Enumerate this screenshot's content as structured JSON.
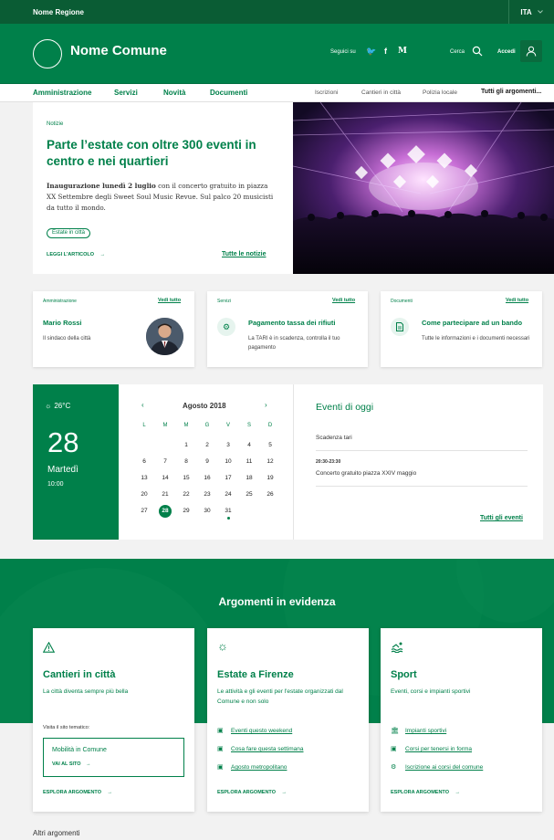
{
  "topbar": {
    "region": "Nome Regione",
    "lang": "ITA"
  },
  "header": {
    "comune": "Nome Comune",
    "follow": "Seguici su",
    "social": [
      "🐦",
      "f",
      "M"
    ],
    "search": "Cerca",
    "login": "Accedi"
  },
  "nav": {
    "main": [
      "Amministrazione",
      "Servizi",
      "Novità",
      "Documenti"
    ],
    "secondary": [
      "Iscrizioni",
      "Cantieri in città",
      "Polizia locale"
    ],
    "all": "Tutti gli argomenti..."
  },
  "hero": {
    "kicker": "Notizie",
    "title": "Parte l’estate con oltre 300 eventi in centro e nei quartieri",
    "text_bold": "Inaugurazione lunedì 2 luglio",
    "text_rest": " con il concerto gratuito in piazza XX Settembre degli Sweet Soul Music Revue. Sul palco 20 musicisti da tutto il mondo.",
    "chip": "Estate in città",
    "read_more": "LEGGI L'ARTICOLO",
    "all_news": "Tutte le notizie"
  },
  "cards": [
    {
      "kicker": "Amministrazione",
      "all": "Vedi tutto",
      "title": "Mario Rossi",
      "sub": "Il sindaco della città"
    },
    {
      "kicker": "Servizi",
      "all": "Vedi tutto",
      "title": "Pagamento tassa dei rifiuti",
      "sub": "La TARI è in scadenza, controlla il tuo pagamento"
    },
    {
      "kicker": "Documenti",
      "all": "Vedi tutto",
      "title": "Come partecipare ad un bando",
      "sub": "Tutte le informazioni e i documenti necessari"
    }
  ],
  "weather": {
    "temp": "26°C",
    "day": "28",
    "weekday": "Martedì",
    "time": "10:00"
  },
  "calendar": {
    "month": "Agosto 2018",
    "dow": [
      "L",
      "M",
      "M",
      "G",
      "V",
      "S",
      "D"
    ],
    "rows": [
      [
        "",
        "",
        "1",
        "2",
        "3",
        "4",
        "5"
      ],
      [
        "6",
        "7",
        "8",
        "9",
        "10",
        "11",
        "12"
      ],
      [
        "13",
        "14",
        "15",
        "16",
        "17",
        "18",
        "19"
      ],
      [
        "20",
        "21",
        "22",
        "23",
        "24",
        "25",
        "26"
      ],
      [
        "27",
        "28",
        "29",
        "30",
        "31",
        "",
        ""
      ]
    ],
    "selected": "28"
  },
  "events": {
    "title": "Eventi di oggi",
    "items": [
      {
        "time": "",
        "name": "Scadenza tari"
      },
      {
        "time": "20:30-23:30",
        "name": "Concerto gratuito piazza XXIV maggio"
      }
    ],
    "all": "Tutti gli eventi"
  },
  "argomenti": {
    "title": "Argomenti in evidenza",
    "cards": [
      {
        "icon": "warning-icon",
        "title": "Cantieri in città",
        "sub": "La città diventa sempre più bella",
        "visit": "Visita il sito tematico:",
        "site_title": "Mobilità in Comune",
        "site_link": "VAI AL SITO",
        "esplora": "ESPLORA ARGOMENTO"
      },
      {
        "icon": "sun-icon",
        "title": "Estate a Firenze",
        "sub": "Le attività e gli eventi per l'estate organizzati dal Comune e non solo",
        "links": [
          "Eventi questo weekend",
          "Cosa fare questa settimana",
          "Agosto metropolitano"
        ],
        "esplora": "ESPLORA ARGOMENTO"
      },
      {
        "icon": "swimmer-icon",
        "title": "Sport",
        "sub": "Eventi, corsi e impianti sportivi",
        "links": [
          "Impianti sportivi",
          "Corsi per tenersi in forma",
          "Iscrizione ai corsi del comune"
        ],
        "esplora": "ESPLORA ARGOMENTO"
      }
    ],
    "more": "Altri argomenti"
  }
}
